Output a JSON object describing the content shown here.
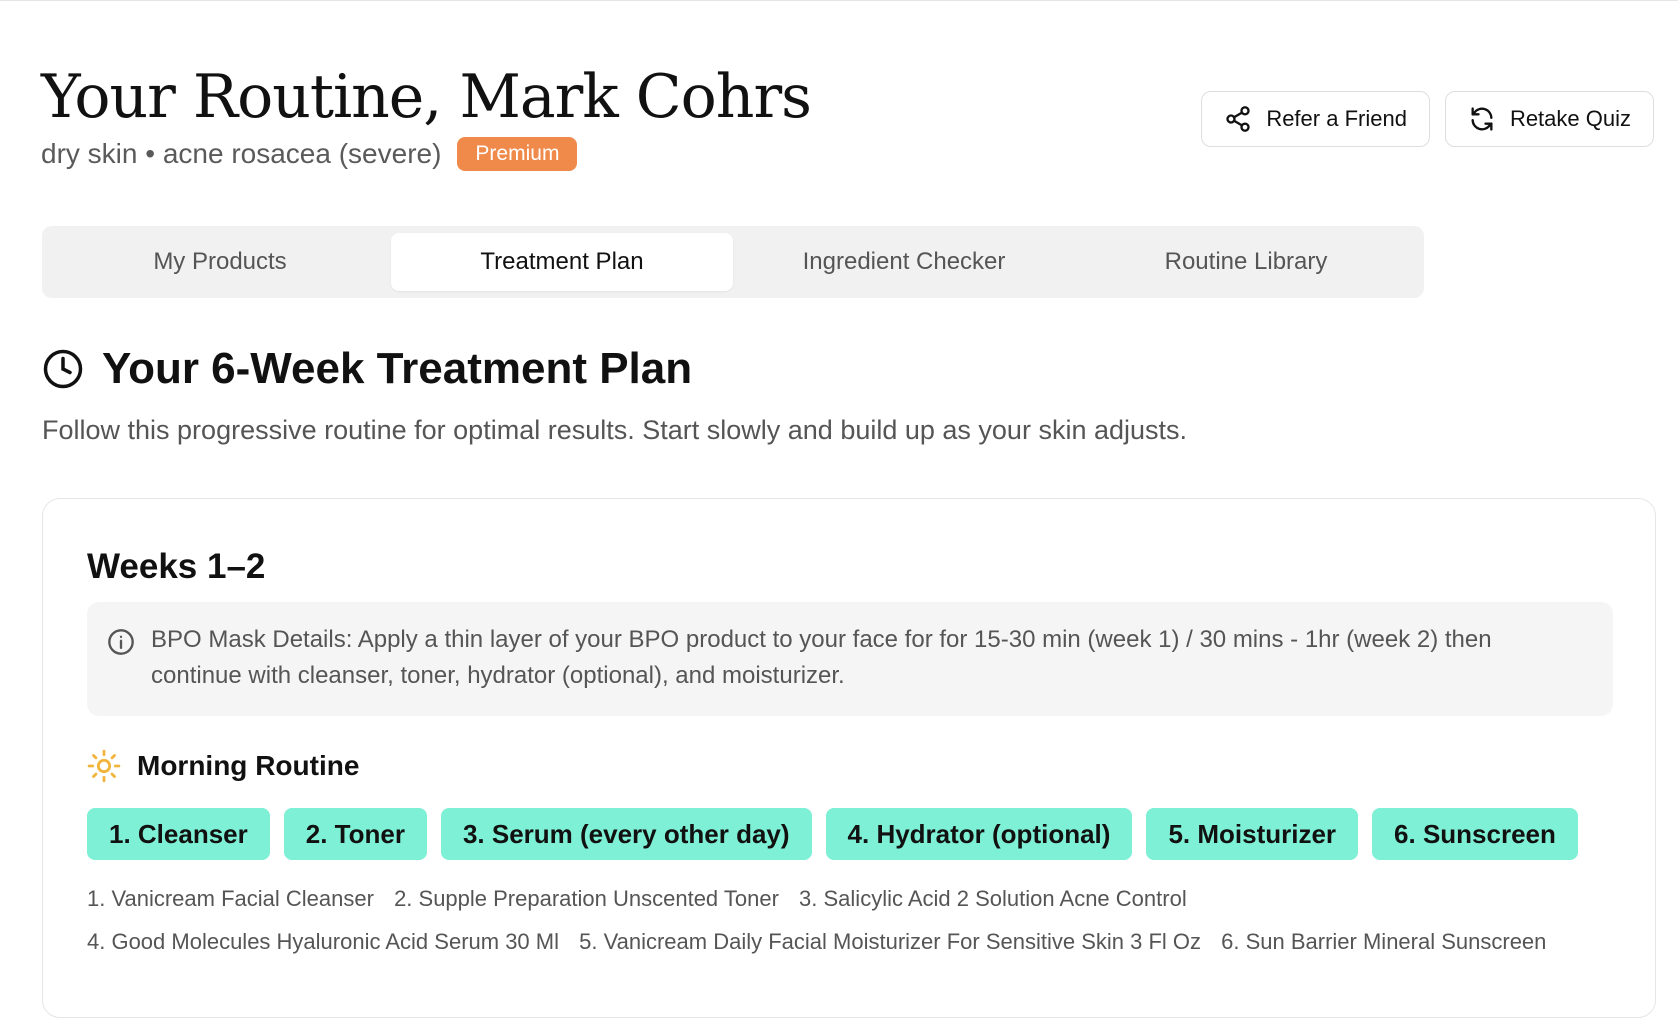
{
  "header": {
    "title": "Your Routine, Mark Cohrs",
    "subtitle": "dry skin • acne rosacea (severe)",
    "badge": "Premium",
    "actions": [
      {
        "label": "Refer a Friend",
        "icon": "share-icon"
      },
      {
        "label": "Retake Quiz",
        "icon": "refresh-icon"
      }
    ]
  },
  "tabs": [
    {
      "label": "My Products",
      "active": false
    },
    {
      "label": "Treatment Plan",
      "active": true
    },
    {
      "label": "Ingredient Checker",
      "active": false
    },
    {
      "label": "Routine Library",
      "active": false
    }
  ],
  "plan": {
    "title": "Your 6-Week Treatment Plan",
    "icon": "clock-icon",
    "description": "Follow this progressive routine for optimal results. Start slowly and build up as your skin adjusts."
  },
  "weeks": {
    "title": "Weeks 1–2",
    "info": "BPO Mask Details: Apply a thin layer of your BPO product to your face for for 15-30 min (week 1) / 30 mins - 1hr (week 2) then continue with cleanser, toner, hydrator (optional), and moisturizer.",
    "info_icon": "info-icon",
    "routine": {
      "title": "Morning Routine",
      "icon": "sun-icon",
      "steps": [
        "1. Cleanser",
        "2. Toner",
        "3. Serum (every other day)",
        "4. Hydrator (optional)",
        "5. Moisturizer",
        "6. Sunscreen"
      ],
      "products": [
        "1. Vanicream Facial Cleanser",
        "2. Supple Preparation Unscented Toner",
        "3. Salicylic Acid 2 Solution Acne Control",
        "4. Good Molecules Hyaluronic Acid Serum 30 Ml",
        "5. Vanicream Daily Facial Moisturizer For Sensitive Skin 3 Fl Oz",
        "6. Sun Barrier Mineral Sunscreen"
      ]
    }
  },
  "colors": {
    "accent_badge": "#f08a4b",
    "step_pill": "#7ef0d5",
    "sun_icon": "#f2b53c"
  }
}
